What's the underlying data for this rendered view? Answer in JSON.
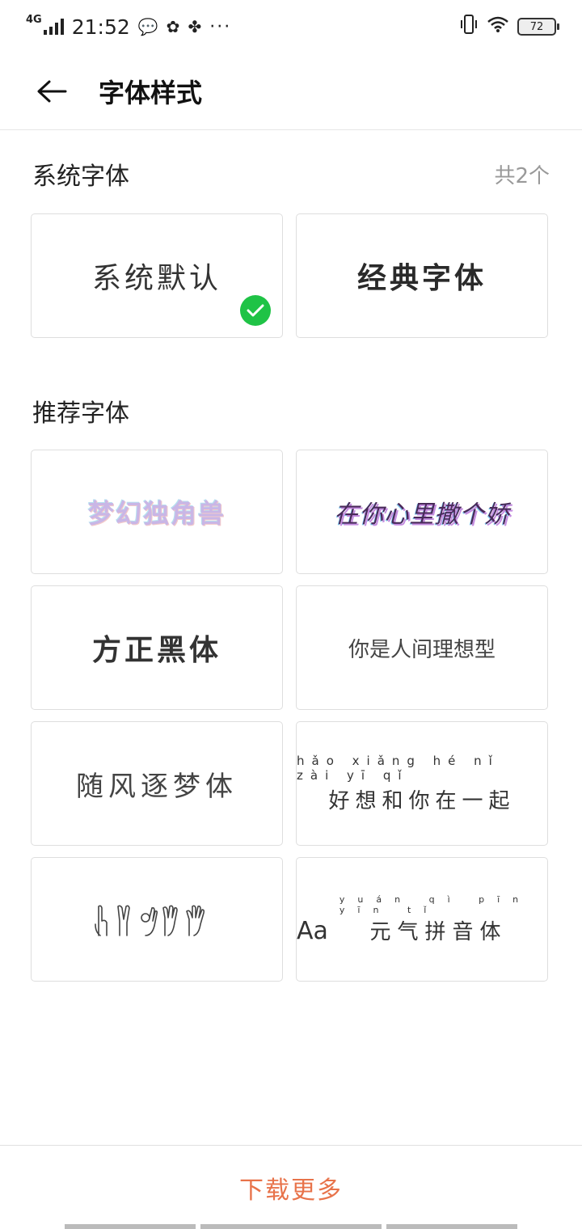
{
  "status_bar": {
    "network": "4G",
    "time": "21:52",
    "battery": "72"
  },
  "header": {
    "title": "字体样式"
  },
  "system_section": {
    "title": "系统字体",
    "count": "共2个",
    "fonts": [
      {
        "label": "系统默认",
        "selected": true
      },
      {
        "label": "经典字体",
        "selected": false
      }
    ]
  },
  "recommended_section": {
    "title": "推荐字体",
    "fonts": [
      {
        "label": "梦幻独角兽"
      },
      {
        "label": "在你心里撒个娇"
      },
      {
        "label": "方正黑体"
      },
      {
        "label": "你是人间理想型"
      },
      {
        "label": "随风逐梦体"
      },
      {
        "label": "好想和你在一起",
        "pinyin": "hǎo xiǎng hé nǐ zài yī qǐ"
      },
      {
        "label": "",
        "icon": "hand-gestures-icon"
      },
      {
        "prefix": "Aa",
        "label": "元气拼音体",
        "pinyin": "yuán qì pīn yīn tǐ"
      }
    ]
  },
  "footer": {
    "download_label": "下载更多"
  },
  "colors": {
    "accent": "#e8734a",
    "check": "#1fc346",
    "border": "#dedede"
  }
}
